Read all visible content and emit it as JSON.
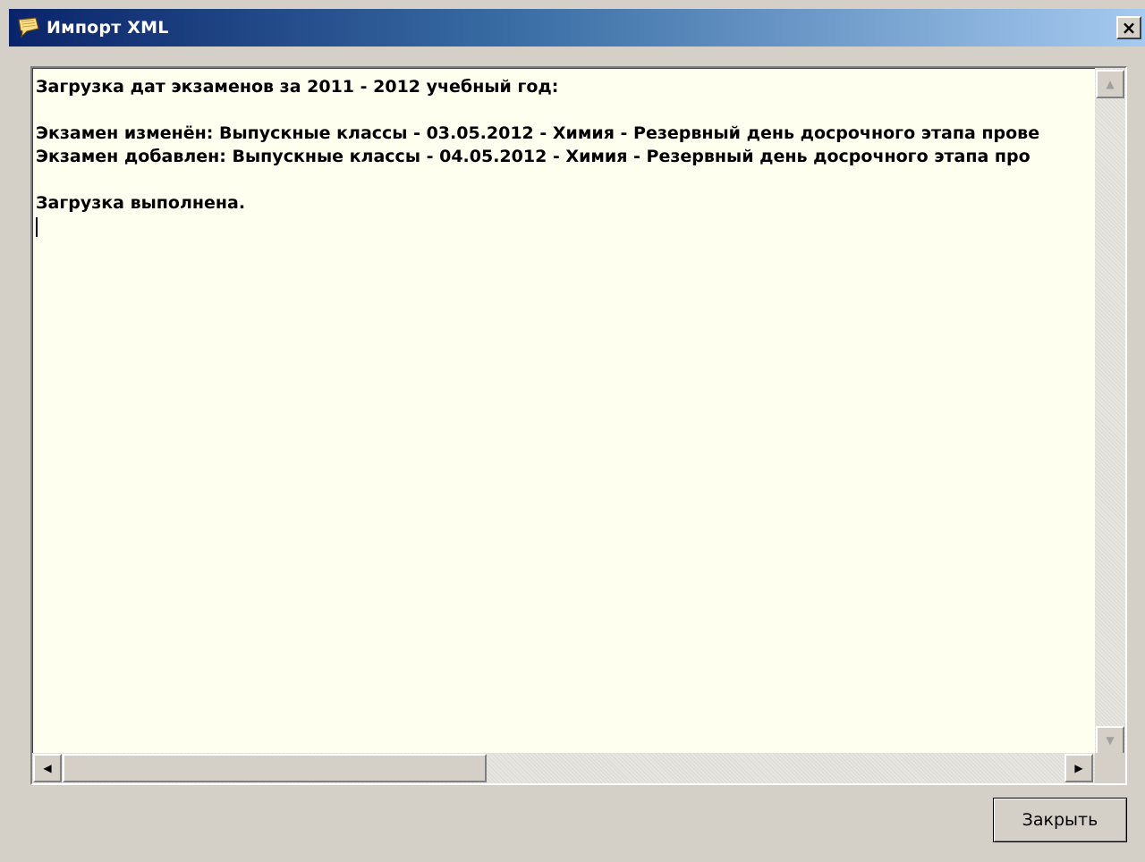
{
  "window": {
    "title": "Импорт XML",
    "close_glyph": "×"
  },
  "log": {
    "lines": [
      "Загрузка дат экзаменов за 2011 - 2012 учебный год:",
      "",
      "Экзамен изменён: Выпускные классы - 03.05.2012 - Химия - Резервный день досрочного этапа прове",
      "Экзамен добавлен: Выпускные классы - 04.05.2012 - Химия - Резервный день досрочного этапа про",
      "",
      "Загрузка выполнена."
    ]
  },
  "scrollbars": {
    "up_glyph": "▲",
    "down_glyph": "▼",
    "left_glyph": "◀",
    "right_glyph": "▶"
  },
  "footer": {
    "close_label": "Закрыть"
  },
  "icons": {
    "app_icon": "speech-bubble-icon"
  },
  "colors": {
    "title_start": "#0a246a",
    "title_end": "#a6caf0",
    "log_background": "#fffff0",
    "window_background": "#d4d0c8"
  }
}
